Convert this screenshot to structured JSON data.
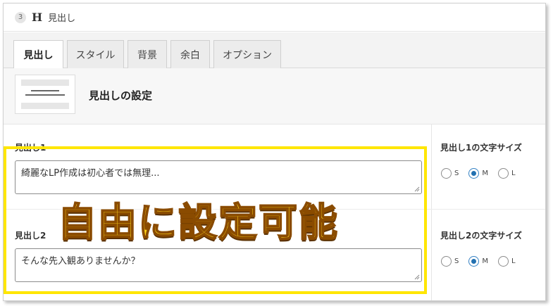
{
  "header": {
    "step": "3",
    "icon": "H",
    "title": "見出し"
  },
  "tabs": [
    {
      "label": "見出し",
      "active": true
    },
    {
      "label": "スタイル",
      "active": false
    },
    {
      "label": "背景",
      "active": false
    },
    {
      "label": "余白",
      "active": false
    },
    {
      "label": "オプション",
      "active": false
    }
  ],
  "settings": {
    "title": "見出しの設定"
  },
  "heading1": {
    "label": "見出し1",
    "value": "綺麗なLP作成は初心者では無理..."
  },
  "heading2": {
    "label": "見出し2",
    "value": "そんな先入観ありませんか？"
  },
  "size1": {
    "label": "見出し1の文字サイズ",
    "options": [
      "S",
      "M",
      "L"
    ],
    "selected": "M"
  },
  "size2": {
    "label": "見出し2の文字サイズ",
    "options": [
      "S",
      "M",
      "L"
    ],
    "selected": "M"
  },
  "overlay": {
    "text": "自由に設定可能"
  },
  "colors": {
    "accent": "#2271b1",
    "highlight": "#ffe600",
    "overlay_fill": "#ffd31a"
  }
}
